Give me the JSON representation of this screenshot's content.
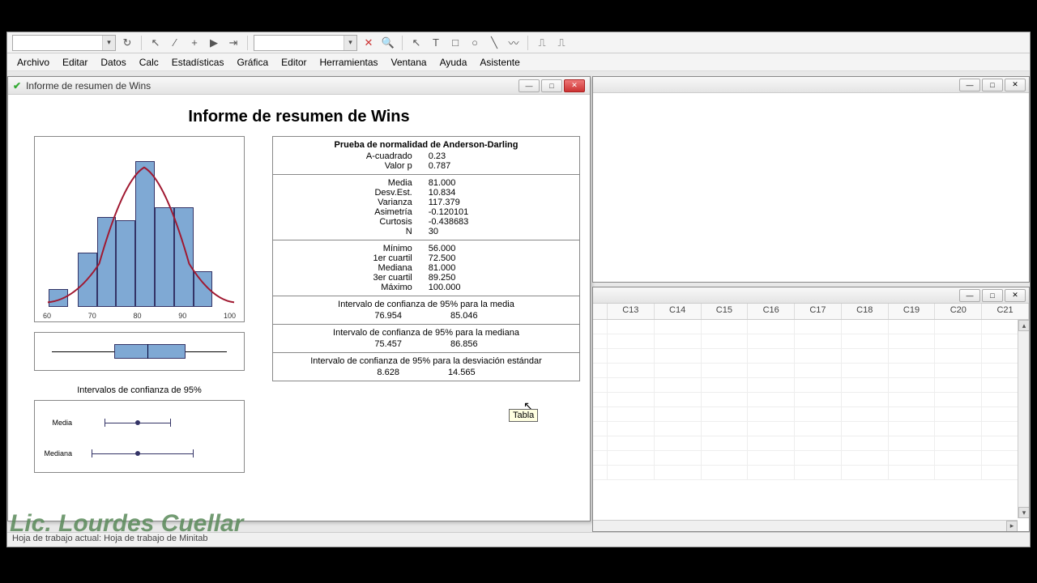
{
  "menubar": [
    "Archivo",
    "Editar",
    "Datos",
    "Calc",
    "Estadísticas",
    "Gráfica",
    "Editor",
    "Herramientas",
    "Ventana",
    "Ayuda",
    "Asistente"
  ],
  "window": {
    "title": "Informe de resumen de Wins"
  },
  "report": {
    "title": "Informe de resumen de Wins",
    "adtest_title": "Prueba de normalidad de Anderson-Darling",
    "a_squared_label": "A-cuadrado",
    "a_squared": "0.23",
    "pvalue_label": "Valor p",
    "pvalue": "0.787",
    "mean_label": "Media",
    "mean": "81.000",
    "stdev_label": "Desv.Est.",
    "stdev": "10.834",
    "variance_label": "Varianza",
    "variance": "117.379",
    "skew_label": "Asimetría",
    "skew": "-0.120101",
    "kurt_label": "Curtosis",
    "kurt": "-0.438683",
    "n_label": "N",
    "n": "30",
    "min_label": "Mínimo",
    "min": "56.000",
    "q1_label": "1er cuartil",
    "q1": "72.500",
    "median_label": "Mediana",
    "median": "81.000",
    "q3_label": "3er cuartil",
    "q3": "89.250",
    "max_label": "Máximo",
    "max": "100.000",
    "ci_mean_title": "Intervalo de confianza de 95% para la media",
    "ci_mean_lo": "76.954",
    "ci_mean_hi": "85.046",
    "ci_median_title": "Intervalo de confianza de 95% para la mediana",
    "ci_median_lo": "75.457",
    "ci_median_hi": "86.856",
    "ci_std_title": "Intervalo de confianza de 95% para la desviación estándar",
    "ci_std_lo": "8.628",
    "ci_std_hi": "14.565",
    "ci_section_title": "Intervalos de confianza de 95%",
    "ci_row_media": "Media",
    "ci_row_mediana": "Mediana"
  },
  "tooltip": "Tabla",
  "columns": [
    "C13",
    "C14",
    "C15",
    "C16",
    "C17",
    "C18",
    "C19",
    "C20",
    "C21"
  ],
  "statusbar": "Hoja de trabajo actual: Hoja de trabajo de Minitab",
  "watermark": "Lic. Lourdes Cuellar",
  "chart_data": {
    "histogram": {
      "type": "bar",
      "title": "",
      "x_ticks": [
        60,
        70,
        80,
        90,
        100
      ],
      "bins": [
        {
          "center": 57.5,
          "freq": 1
        },
        {
          "center": 65.0,
          "freq": 3
        },
        {
          "center": 70.0,
          "freq": 5
        },
        {
          "center": 75.0,
          "freq": 4.8
        },
        {
          "center": 80.0,
          "freq": 8
        },
        {
          "center": 85.0,
          "freq": 5.5
        },
        {
          "center": 90.0,
          "freq": 5.5
        },
        {
          "center": 95.0,
          "freq": 2
        },
        {
          "center": 100.0,
          "freq": 0
        }
      ],
      "fit_curve": "normal",
      "xlim": [
        55,
        105
      ],
      "ylim": [
        0,
        9
      ]
    },
    "boxplot": {
      "type": "boxplot",
      "min": 56,
      "q1": 72.5,
      "median": 81,
      "q3": 89.25,
      "max": 100
    },
    "ci_plot": {
      "type": "interval",
      "rows": [
        {
          "name": "Media",
          "lo": 76.954,
          "pt": 81.0,
          "hi": 85.046
        },
        {
          "name": "Mediana",
          "lo": 75.457,
          "pt": 81.0,
          "hi": 86.856
        }
      ],
      "xlim": [
        74,
        88
      ]
    }
  }
}
